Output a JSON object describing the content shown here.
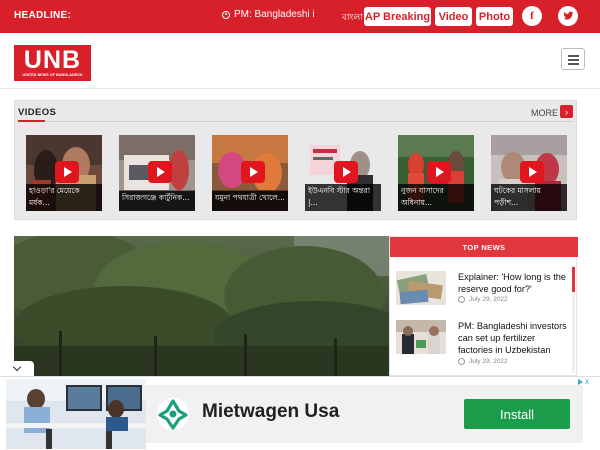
{
  "topbar": {
    "headline_label": "HEADLINE:",
    "ticker_text": "PM: Bangladeshi i",
    "lang_label": "বাংলা",
    "buttons": [
      "AP Breaking",
      "Video",
      "Photo"
    ],
    "social": {
      "facebook_glyph": "f",
      "twitter_glyph": "🐦"
    }
  },
  "header": {
    "logo_text": "UNB",
    "logo_sub": "UNITED NEWS OF BANGLADESH"
  },
  "videos": {
    "title": "VIDEOS",
    "more_label": "MORE",
    "more_glyph": "›",
    "items": [
      {
        "line1": "হাওড়া'র মেয়েকে",
        "line2": "মর্ষক..."
      },
      {
        "line1": "সিরাজগঞ্জে কার্টুনিক...",
        "line2": ""
      },
      {
        "line1": "যমুনা পথযাত্রী খোলে...",
        "line2": ""
      },
      {
        "line1": "ইউএনবি স্টার অন্তরা",
        "line2": "|..."
      },
      {
        "line1": "নুজন যাসাদের",
        "line2": "অধিনায়..."
      },
      {
        "line1": "ঘটকের মাসলায়",
        "line2": "পড়ীশ..."
      }
    ]
  },
  "top_news": {
    "heading": "TOP NEWS",
    "items": [
      {
        "title": "Explainer: 'How long is the reserve good for?'",
        "date": "July 29, 2022"
      },
      {
        "title": "PM: Bangladeshi investors can set up fertilizer factories in Uzbekistan",
        "date": "July 29, 2022"
      }
    ]
  },
  "ad": {
    "brand": "Mietwagen Usa",
    "install_label": "Install",
    "close_glyph": "x"
  },
  "colors": {
    "brand_red": "#d8202a",
    "topnews_red": "#e03640",
    "install_green": "#1a9c4b"
  }
}
